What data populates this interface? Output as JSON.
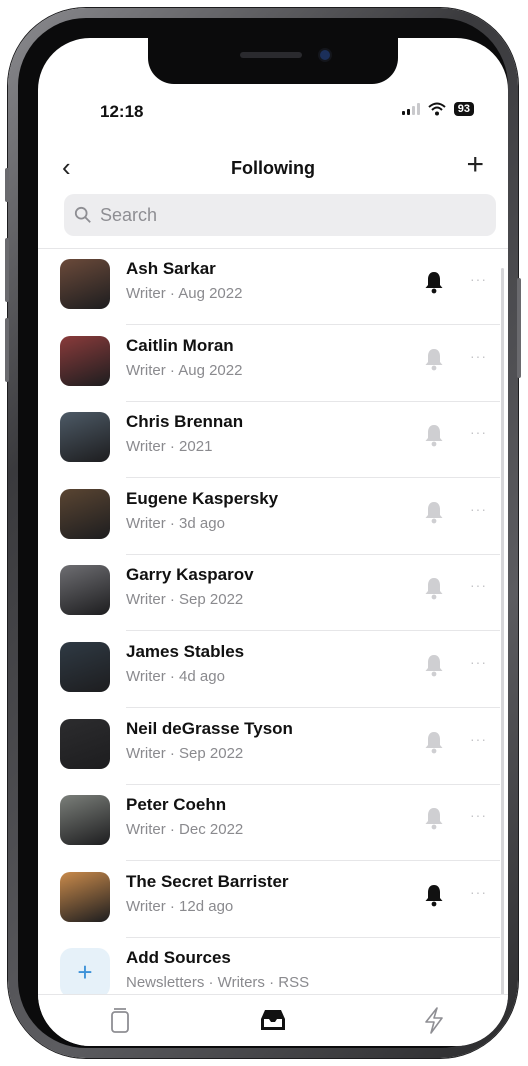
{
  "status": {
    "time": "12:18",
    "battery": "93"
  },
  "nav": {
    "back_icon": "chevron-left-icon",
    "title": "Following",
    "add_icon": "plus-icon"
  },
  "search": {
    "placeholder": "Search"
  },
  "list": [
    {
      "name": "Ash Sarkar",
      "subtitle": "Writer · Aug 2022",
      "notifications": true,
      "avatar_color": "#6b4a3a"
    },
    {
      "name": "Caitlin Moran",
      "subtitle": "Writer · Aug 2022",
      "notifications": false,
      "avatar_color": "#8a3b3b"
    },
    {
      "name": "Chris Brennan",
      "subtitle": "Writer · 2021",
      "notifications": false,
      "avatar_color": "#4d5a66"
    },
    {
      "name": "Eugene Kaspersky",
      "subtitle": "Writer · 3d ago",
      "notifications": false,
      "avatar_color": "#5a4532"
    },
    {
      "name": "Garry  Kasparov",
      "subtitle": "Writer · Sep 2022",
      "notifications": false,
      "avatar_color": "#6e6e72"
    },
    {
      "name": "James Stables",
      "subtitle": "Writer · 4d ago",
      "notifications": false,
      "avatar_color": "#2f3a44"
    },
    {
      "name": "Neil deGrasse Tyson",
      "subtitle": "Writer · Sep 2022",
      "notifications": false,
      "avatar_color": "#2c2c2e"
    },
    {
      "name": "Peter Coehn",
      "subtitle": "Writer · Dec 2022",
      "notifications": false,
      "avatar_color": "#7b7f7a"
    },
    {
      "name": "The Secret Barrister",
      "subtitle": "Writer · 12d ago",
      "notifications": true,
      "avatar_color": "#c98a4b"
    }
  ],
  "add_sources": {
    "label": "Add Sources",
    "subtitle": "Newsletters · Writers · RSS"
  },
  "colors": {
    "bell_on": "#111111",
    "bell_off": "#cfcfd2",
    "accent": "#3d92d8"
  },
  "tabbar": {
    "icons": [
      "library-icon",
      "inbox-icon",
      "bolt-icon"
    ],
    "selected": 1
  }
}
